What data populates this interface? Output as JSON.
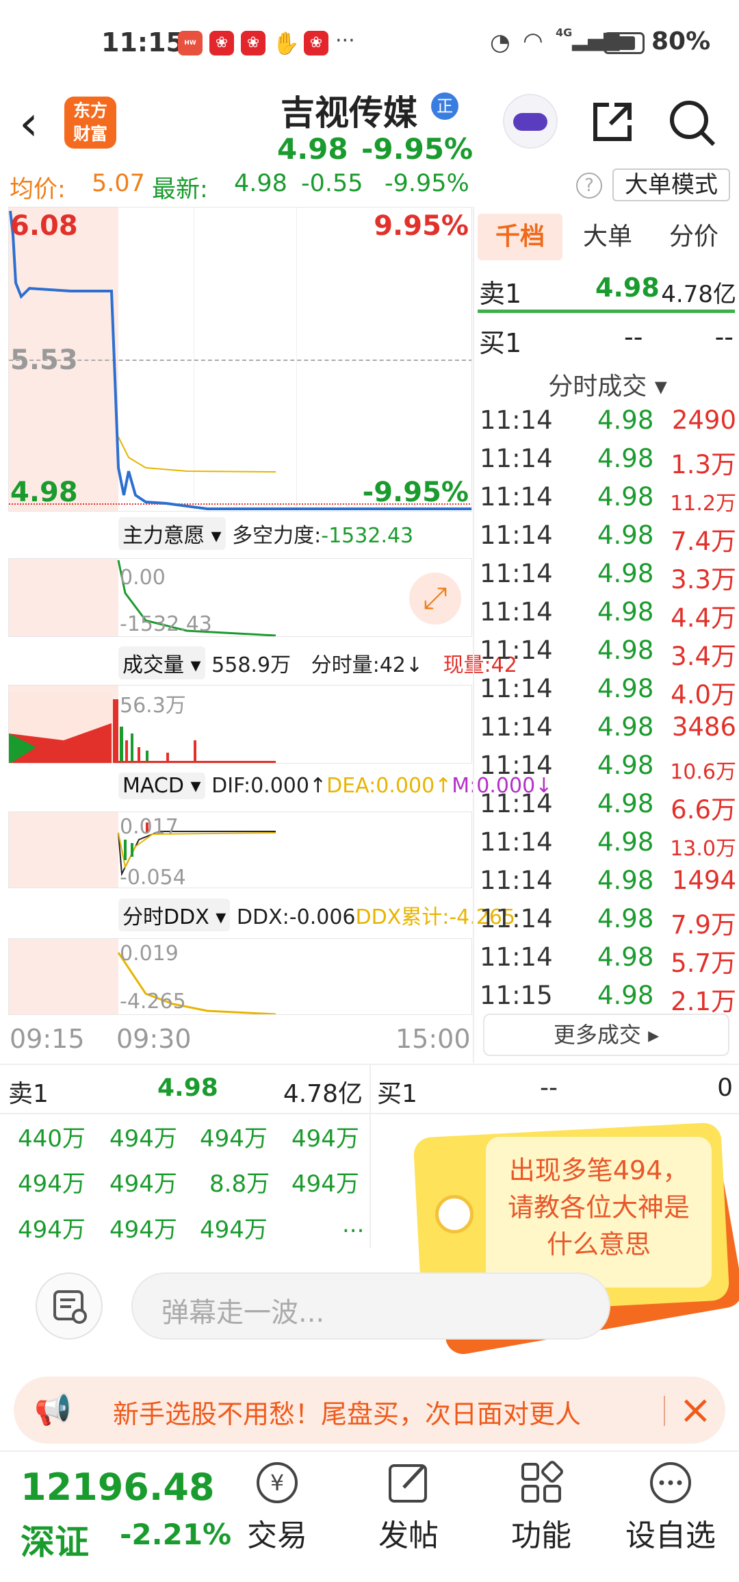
{
  "status_bar": {
    "time": "11:15",
    "icon_labels": [
      "HUAWEI",
      "app-icon",
      "app-icon",
      "hand-icon",
      "app-icon"
    ],
    "more": "···",
    "network": "4G",
    "battery": "80%"
  },
  "header": {
    "stock_name": "吉视传媒",
    "badge": "正",
    "price": "4.98",
    "change_pct": "-9.95%",
    "logo_line1": "东方",
    "logo_line2": "财富"
  },
  "info_line": {
    "avg_label": "均价:",
    "avg": "5.07",
    "latest_label": "最新:",
    "latest": "4.98",
    "change": "-0.55",
    "pct": "-9.95%",
    "help": "?",
    "mode_button": "大单模式"
  },
  "price_chart": {
    "high": "6.08",
    "high_pct": "9.95%",
    "mid": "5.53",
    "low": "4.98",
    "low_pct": "-9.95%"
  },
  "main_force": {
    "dropdown": "主力意愿",
    "label": "多空力度:",
    "value": "-1532.43",
    "axis_top": "0.00",
    "axis_bottom": "-1532.43"
  },
  "volume": {
    "dropdown": "成交量",
    "total": "558.9万",
    "split_label": "分时量:42↓",
    "now_label": "现量:42",
    "axis": "56.3万"
  },
  "macd": {
    "dropdown": "MACD",
    "dif": "DIF:0.000↑",
    "dea": "DEA:0.000↑",
    "m": "M:0.000↓",
    "axis_top": "0.017",
    "axis_bottom": "-0.054"
  },
  "ddx": {
    "dropdown": "分时DDX",
    "ddx": "DDX:-0.006",
    "ddx_sum": "DDX累计:-4.265",
    "axis_top": "0.019",
    "axis_bottom": "-4.265"
  },
  "time_axis": [
    "09:15",
    "09:30",
    "15:00"
  ],
  "right_panel": {
    "tabs": [
      "千档",
      "大单",
      "分价"
    ],
    "sell1": {
      "label": "卖1",
      "price": "4.98",
      "vol": "4.78亿"
    },
    "buy1": {
      "label": "买1",
      "price": "--",
      "vol": "--"
    },
    "trades_title": "分时成交",
    "trades": [
      {
        "time": "11:14",
        "price": "4.98",
        "vol": "2490"
      },
      {
        "time": "11:14",
        "price": "4.98",
        "vol": "1.3万"
      },
      {
        "time": "11:14",
        "price": "4.98",
        "vol": "11.2万"
      },
      {
        "time": "11:14",
        "price": "4.98",
        "vol": "7.4万"
      },
      {
        "time": "11:14",
        "price": "4.98",
        "vol": "3.3万"
      },
      {
        "time": "11:14",
        "price": "4.98",
        "vol": "4.4万"
      },
      {
        "time": "11:14",
        "price": "4.98",
        "vol": "3.4万"
      },
      {
        "time": "11:14",
        "price": "4.98",
        "vol": "4.0万"
      },
      {
        "time": "11:14",
        "price": "4.98",
        "vol": "3486"
      },
      {
        "time": "11:14",
        "price": "4.98",
        "vol": "10.6万"
      },
      {
        "time": "11:14",
        "price": "4.98",
        "vol": "6.6万"
      },
      {
        "time": "11:14",
        "price": "4.98",
        "vol": "13.0万"
      },
      {
        "time": "11:14",
        "price": "4.98",
        "vol": "1494"
      },
      {
        "time": "11:14",
        "price": "4.98",
        "vol": "7.9万"
      },
      {
        "time": "11:14",
        "price": "4.98",
        "vol": "5.7万"
      },
      {
        "time": "11:15",
        "price": "4.98",
        "vol": "2.1万"
      }
    ],
    "more_button": "更多成交"
  },
  "bottom_quote": {
    "sell": {
      "label": "卖1",
      "price": "4.98",
      "vol": "4.78亿"
    },
    "buy": {
      "label": "买1",
      "price": "--",
      "vol": "0"
    },
    "queue": [
      "440万",
      "494万",
      "494万",
      "494万",
      "494万",
      "494万",
      "8.8万",
      "494万",
      "494万",
      "494万",
      "494万",
      "..."
    ]
  },
  "tag_note": [
    "出现多笔494，",
    "请教各位大神是",
    "什么意思"
  ],
  "danmaku": {
    "placeholder": "弹幕走一波..."
  },
  "banner": {
    "text": "新手选股不用愁！尾盘买，次日面对更人"
  },
  "bottom_nav": {
    "index_value": "12196.48",
    "index_name": "深证",
    "index_change": "-2.21%",
    "items": [
      "交易",
      "发帖",
      "功能",
      "设自选"
    ]
  }
}
